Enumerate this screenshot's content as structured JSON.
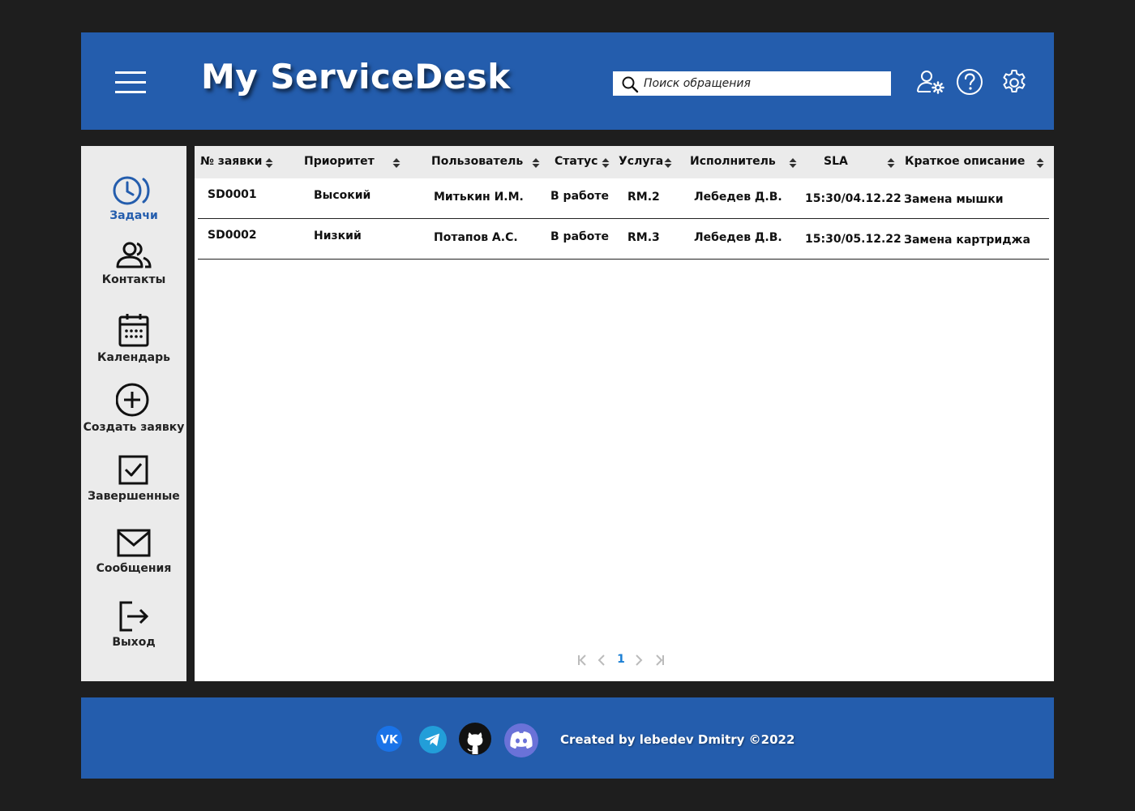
{
  "header": {
    "logo": "My ServiceDesk",
    "search_placeholder": "Поиск обращения"
  },
  "sidebar": {
    "items": [
      {
        "label": "Задачи",
        "icon": "clock-icon",
        "active": true
      },
      {
        "label": "Контакты",
        "icon": "contacts-icon"
      },
      {
        "label": "Календарь",
        "icon": "calendar-icon"
      },
      {
        "label": "Создать заявку",
        "icon": "plus-circle-icon"
      },
      {
        "label": "Завершенные",
        "icon": "checkbox-icon"
      },
      {
        "label": "Сообщения",
        "icon": "envelope-icon"
      },
      {
        "label": "Выход",
        "icon": "logout-icon"
      }
    ]
  },
  "table": {
    "columns": [
      "№ заявки",
      "Приоритет",
      "Пользователь",
      "Статус",
      "Услуга",
      "Исполнитель",
      "SLA",
      "Краткое описание"
    ],
    "rows": [
      [
        "SD0001",
        "Высокий",
        "Митькин И.М.",
        "В работе",
        "RM.2",
        "Лебедев Д.В.",
        "15:30/04.12.22",
        "Замена мышки"
      ],
      [
        "SD0002",
        "Низкий",
        "Потапов А.С.",
        "В работе",
        "RM.3",
        "Лебедев Д.В.",
        "15:30/05.12.22",
        "Замена картриджа"
      ]
    ]
  },
  "pagination": {
    "current_page": "1"
  },
  "footer": {
    "credit": "Created by lebedev Dmitry ©2022",
    "social_icons": [
      "vk-icon",
      "telegram-icon",
      "github-icon",
      "discord-icon"
    ]
  },
  "colors": {
    "brand": "#245dad",
    "background": "#1e1e1e",
    "panel": "#ebebeb",
    "active_nav": "#245dad",
    "page_link": "#1b7fd4"
  }
}
